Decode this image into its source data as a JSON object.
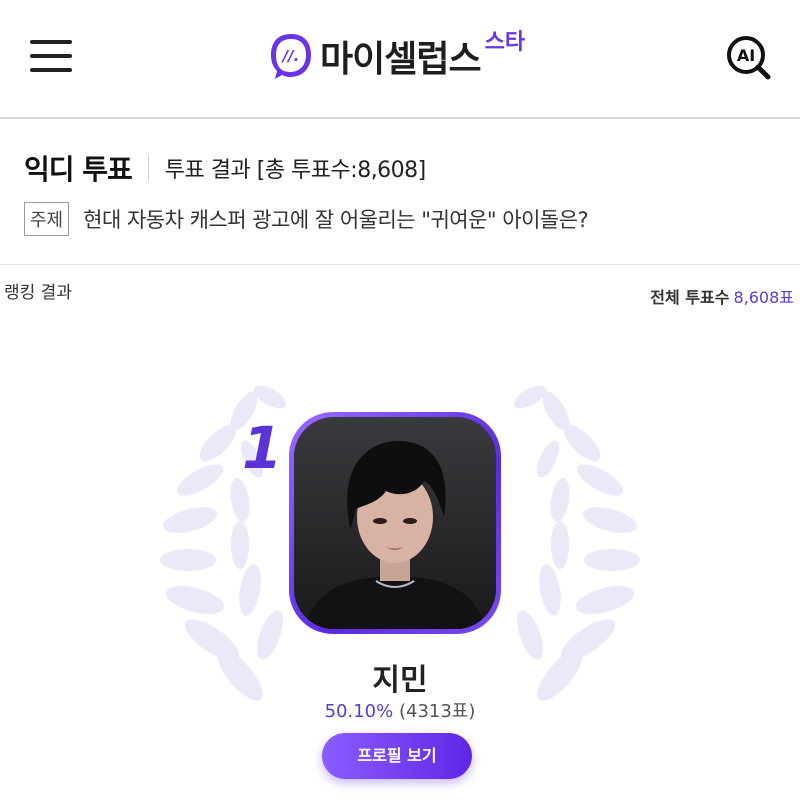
{
  "header": {
    "logo_text": "마이셀럽스",
    "logo_sup": "스타",
    "logo_mark_text": "//.",
    "ai_text": "AI",
    "brand_color": "#6a33e8"
  },
  "vote": {
    "title": "익디 투표",
    "meta": "투표 결과 [총 투표수:8,608]",
    "topic_tag": "주제",
    "topic": "현대 자동차 캐스퍼 광고에 잘 어울리는 \"귀여운\" 아이돌은?"
  },
  "ranking": {
    "label": "랭킹 결과",
    "total_label": "전체 투표수",
    "total_value": "8,608표",
    "first": {
      "rank": "1",
      "name": "지민",
      "percent": "50.10%",
      "votes": "(4313표)",
      "button_label": "프로필 보기"
    },
    "accent_color": "#5c34d6"
  }
}
